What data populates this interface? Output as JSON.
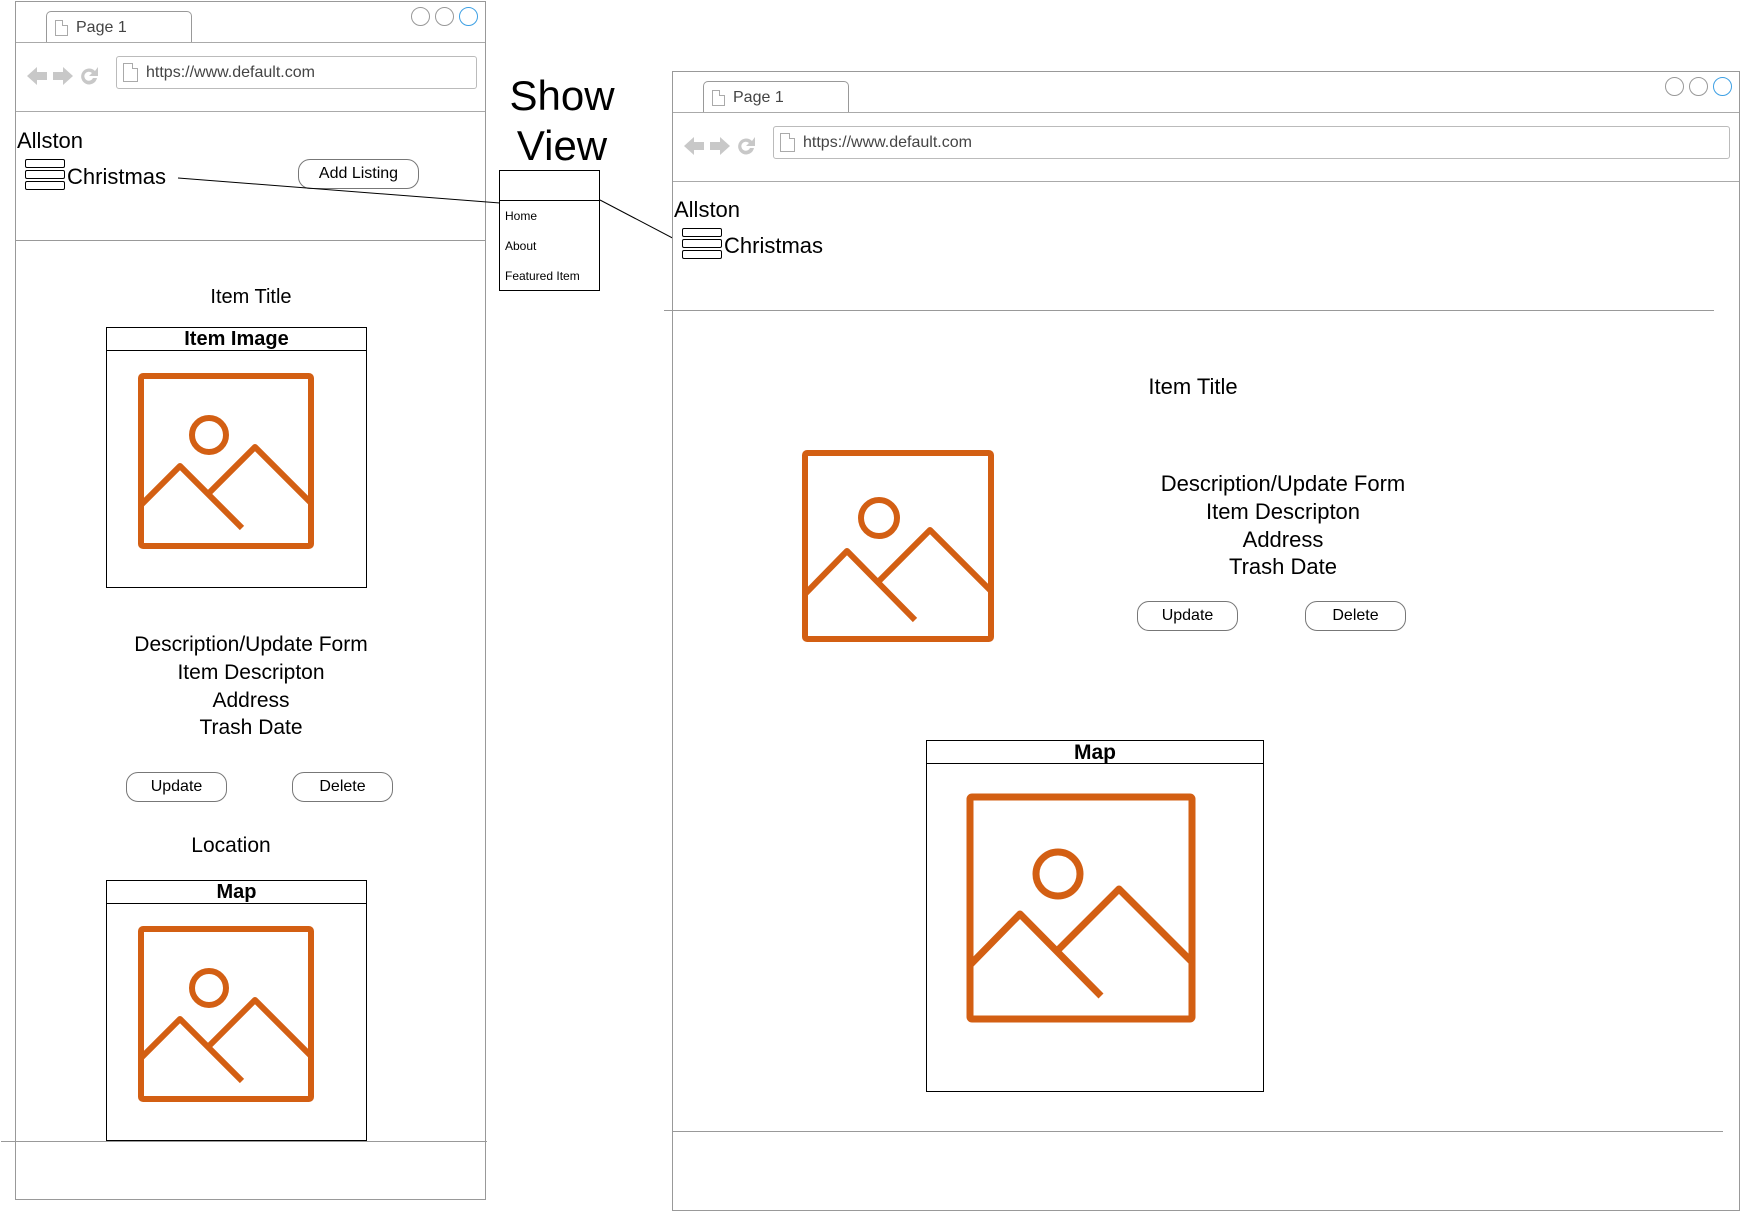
{
  "browser": {
    "tab_label": "Page 1",
    "url": "https://www.default.com"
  },
  "site": {
    "brand": "Allston",
    "title": "Christmas"
  },
  "left_view": {
    "add_listing_label": "Add Listing",
    "item_title": "Item Title",
    "item_image_label": "Item Image",
    "form_lines": [
      "Description/Update Form",
      "Item Descripton",
      "Address",
      "Trash Date"
    ],
    "update_label": "Update",
    "delete_label": "Delete",
    "location_label": "Location",
    "map_label": "Map"
  },
  "annotation": {
    "heading_line1": "Show",
    "heading_line2": "View",
    "menu_items": [
      "Home",
      "About",
      "Featured Item"
    ]
  },
  "right_view": {
    "item_title": "Item Title",
    "form_lines": [
      "Description/Update Form",
      "Item Descripton",
      "Address",
      "Trash Date"
    ],
    "update_label": "Update",
    "delete_label": "Delete",
    "map_label": "Map"
  },
  "colors": {
    "image_icon": "#d35f13",
    "active_circle": "#3ea0e4"
  }
}
